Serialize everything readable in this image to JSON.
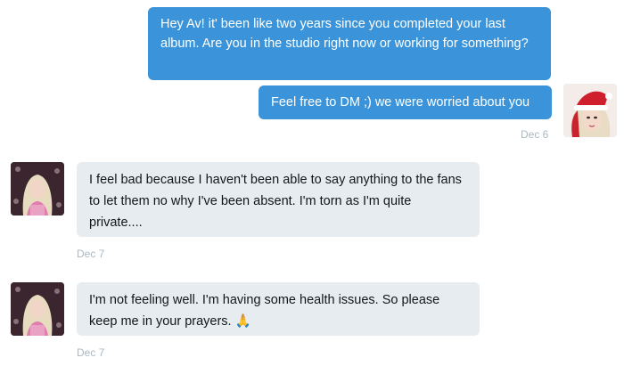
{
  "messages": [
    {
      "direction": "outgoing",
      "text": "Hey Av! it' been like two years since you completed your last album. Are you in the studio right now or working for something?"
    },
    {
      "direction": "outgoing",
      "text": "Feel free to DM ;) we were worried about you"
    },
    {
      "direction": "incoming",
      "text": "I feel bad because I haven't been able to say anything to the fans to let them no why I've been absent. I'm torn as I'm quite private...."
    },
    {
      "direction": "incoming",
      "text": "I'm not feeling well. I'm having some health issues. So please keep me in your prayers. 🙏"
    }
  ],
  "timestamps": {
    "outgoing_group": "Dec 6",
    "incoming_1": "Dec 7",
    "incoming_2": "Dec 7"
  },
  "colors": {
    "outgoing_bubble": "#3b94d9",
    "incoming_bubble": "#e6ecf0",
    "timestamp": "#aab8c2"
  },
  "icons": {
    "sender_avatar": "santa-hat-avatar",
    "recipient_avatar": "profile-photo-avatar"
  }
}
